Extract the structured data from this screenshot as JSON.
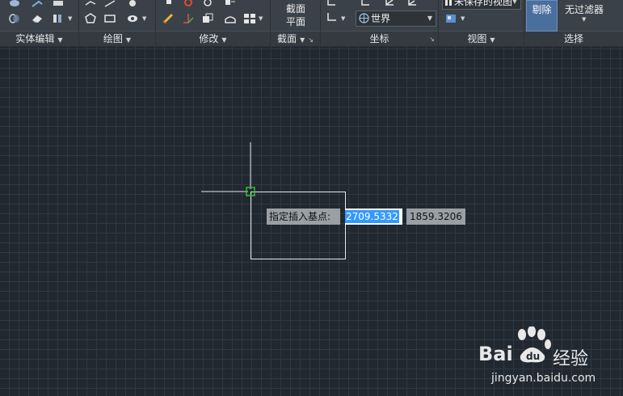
{
  "ribbon": {
    "panels": [
      {
        "title": "实体编辑"
      },
      {
        "title": "绘图"
      },
      {
        "title": "修改"
      },
      {
        "title": "截面"
      },
      {
        "title": "坐标"
      },
      {
        "title": "视图"
      },
      {
        "title": "选择"
      }
    ],
    "section_button": {
      "line1": "截面",
      "line2": "平面"
    },
    "coordinate_combo": {
      "value": "世界"
    },
    "view_combo": {
      "value": "未保存的视图"
    },
    "remove_button": {
      "label": "剔除"
    },
    "filter": {
      "label": "无过滤器"
    }
  },
  "canvas": {
    "prompt_label": "指定插入基点:",
    "x_value": "2709.5332",
    "y_value": "1859.3206"
  },
  "watermark": {
    "brand": "Bai",
    "brand_tail": "经验",
    "url": "jingyan.baidu.com"
  },
  "colors": {
    "ribbon_bg": "#3b4148",
    "canvas_bg": "#212830",
    "selection_blue": "#3399ff",
    "snap_marker": "#2ec22e"
  }
}
